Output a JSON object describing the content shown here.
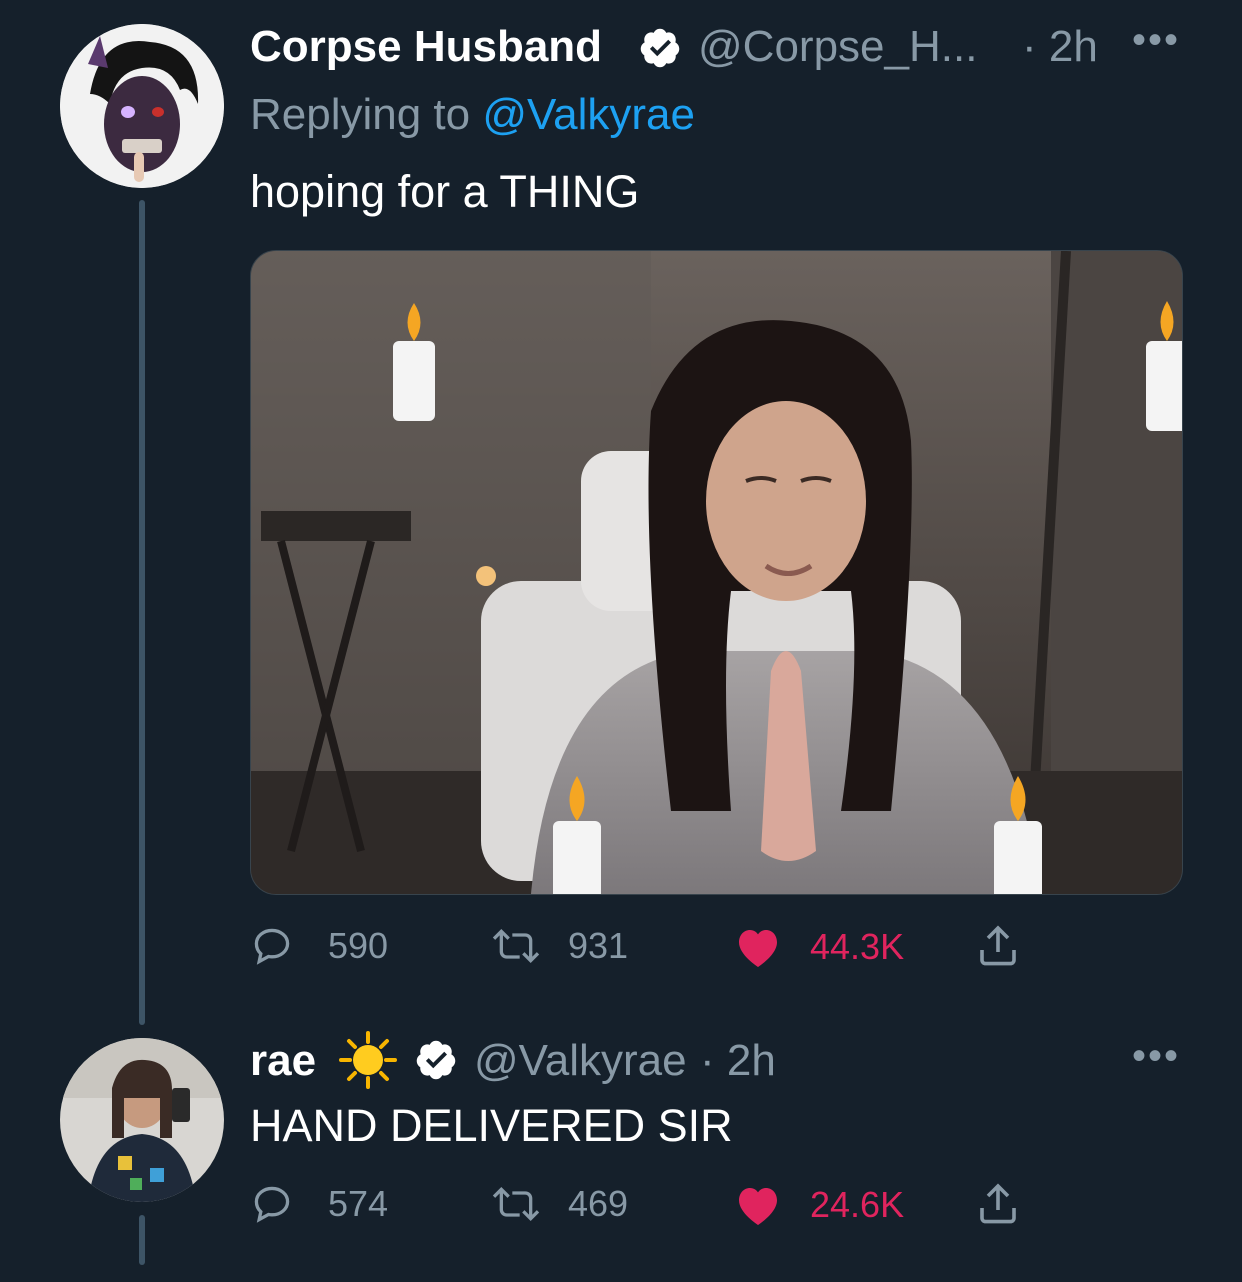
{
  "tweet1": {
    "display_name": "Corpse Husband",
    "handle": "@Corpse_H...",
    "time": "· 2h",
    "replying_label": "Replying to",
    "replying_handle": "@Valkyrae",
    "text": "hoping for a THING",
    "actions": {
      "replies": "590",
      "retweets": "931",
      "likes": "44.3K"
    },
    "verified": true
  },
  "tweet2": {
    "display_name": "rae",
    "handle": "@Valkyrae",
    "time": "· 2h",
    "text": "HAND DELIVERED SIR",
    "actions": {
      "replies": "574",
      "retweets": "469",
      "likes": "24.6K"
    },
    "verified": true
  },
  "icons": {
    "verified": "verified-badge-icon",
    "reply": "reply-bubble-icon",
    "retweet": "retweet-icon",
    "like": "heart-filled-icon",
    "share": "share-icon",
    "more": "more-dots-icon",
    "sun_emoji": "sun-emoji-icon"
  },
  "colors": {
    "background": "#15202b",
    "muted": "#8899a6",
    "link": "#1da1f2",
    "like": "#e0245e",
    "thread_line": "#3d5466"
  }
}
